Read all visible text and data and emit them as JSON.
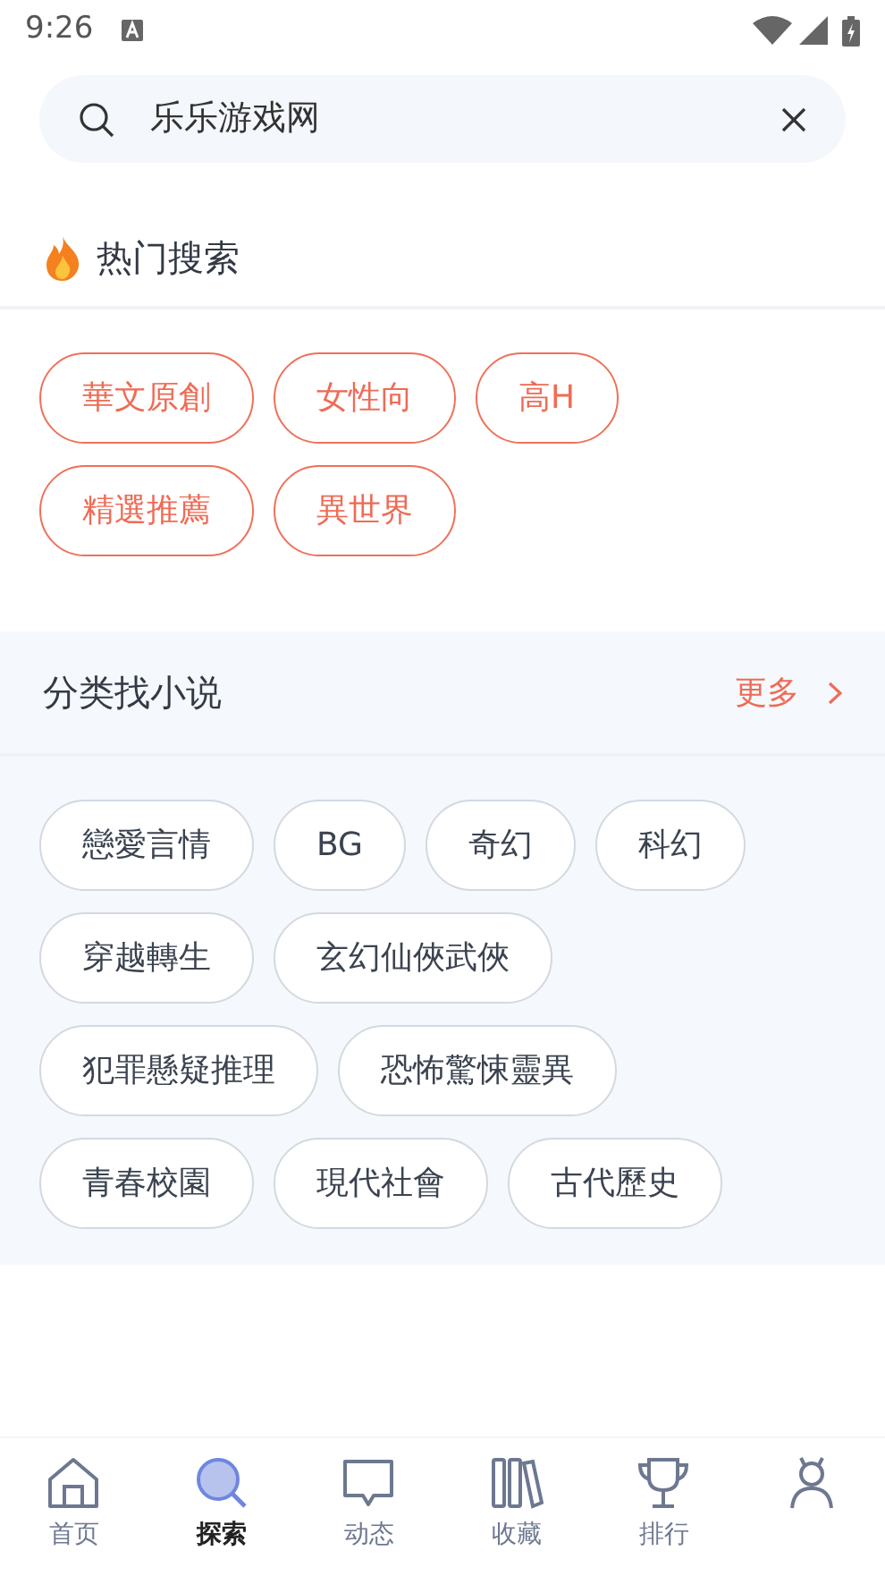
{
  "status_bar": {
    "time": "9:26"
  },
  "search": {
    "value": "乐乐游戏网"
  },
  "hot_search": {
    "title": "热门搜索",
    "tags": [
      "華文原創",
      "女性向",
      "高H",
      "精選推薦",
      "異世界"
    ]
  },
  "categories": {
    "title": "分类找小说",
    "more": "更多",
    "tags": [
      "戀愛言情",
      "BG",
      "奇幻",
      "科幻",
      "穿越轉生",
      "玄幻仙俠武俠",
      "犯罪懸疑推理",
      "恐怖驚悚靈異",
      "青春校園",
      "現代社會",
      "古代歷史"
    ]
  },
  "bottom_nav": [
    {
      "kind": "home",
      "label": "首页",
      "selected": false
    },
    {
      "kind": "search",
      "label": "探索",
      "selected": true
    },
    {
      "kind": "chat",
      "label": "动态",
      "selected": false
    },
    {
      "kind": "books",
      "label": "收藏",
      "selected": false
    },
    {
      "kind": "trophy",
      "label": "排行",
      "selected": false
    },
    {
      "kind": "profile",
      "selected": false
    }
  ]
}
